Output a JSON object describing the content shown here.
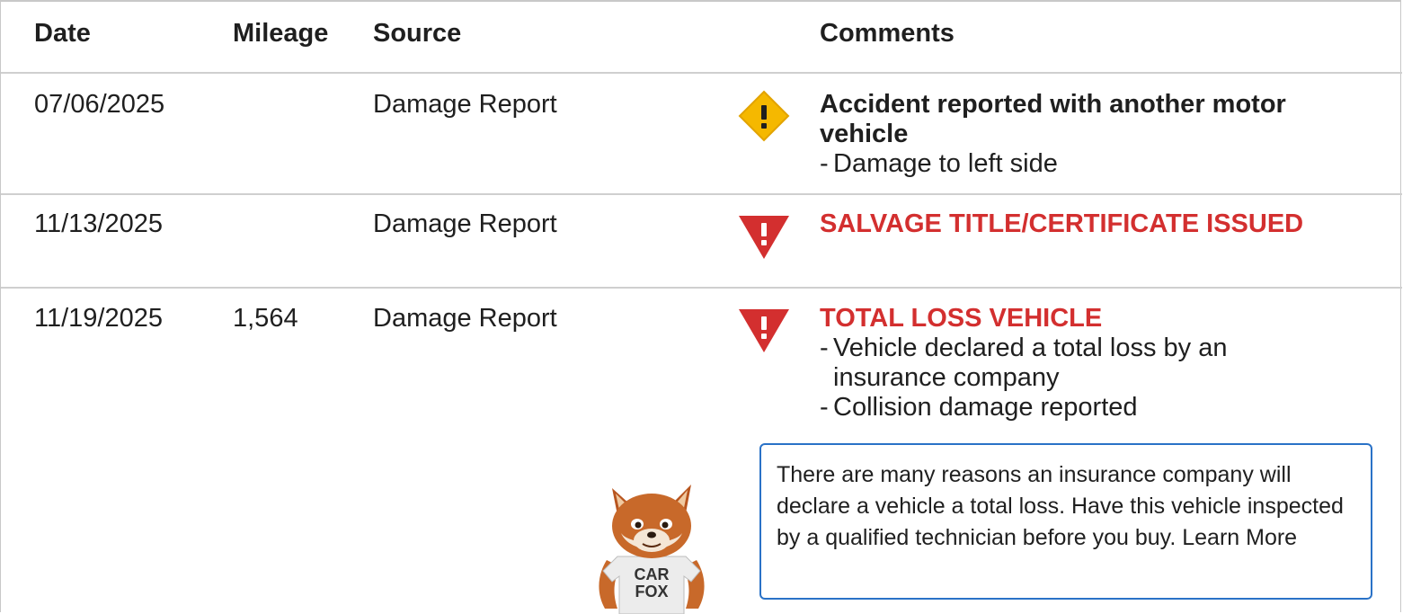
{
  "columns": {
    "date": "Date",
    "mileage": "Mileage",
    "source": "Source",
    "comments": "Comments"
  },
  "rows": [
    {
      "date": "07/06/2025",
      "mileage": "",
      "source": "Damage Report",
      "icon": "warning-diamond-icon",
      "title": "Accident reported with another motor vehicle",
      "details": [
        "Damage to left side"
      ]
    },
    {
      "date": "11/13/2025",
      "mileage": "",
      "source": "Damage Report",
      "icon": "alert-triangle-icon",
      "title": "SALVAGE TITLE/CERTIFICATE ISSUED",
      "details": []
    },
    {
      "date": "11/19/2025",
      "mileage": "1,564",
      "source": "Damage Report",
      "icon": "alert-triangle-icon",
      "title": "TOTAL LOSS VEHICLE",
      "details": [
        "Vehicle declared a total loss by an insurance company",
        "Collision damage reported"
      ]
    }
  ],
  "callout": {
    "text": "There are many reasons an insurance company will declare a vehicle a total loss. Have this vehicle inspected by a qualified technician before you buy.",
    "link": "Learn More"
  },
  "mascot": {
    "shirt_line1": "CAR",
    "shirt_line2": "FOX"
  },
  "colors": {
    "critical": "#d32f2f",
    "warning": "#f5b800",
    "callout_border": "#2a72c7"
  }
}
